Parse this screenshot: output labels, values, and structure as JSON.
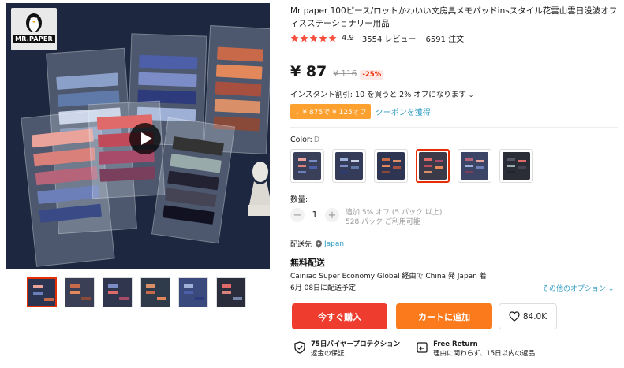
{
  "gallery": {
    "logo_text": "MR.PAPER",
    "thumbnail_count": 6
  },
  "product": {
    "title": "Mr paper 100ピース/ロットかわいい文房具メモパッドinsスタイル花雲山雲日没波オフィスステーショナリー用品",
    "rating": "4.9",
    "reviews": "3554 レビュー",
    "orders": "6591 注文"
  },
  "price": {
    "current": "¥ 87",
    "original": "¥ 116",
    "discount": "-25%"
  },
  "promo": {
    "instant_discount": "インスタント割引: 10 を買うと 2% オフになります",
    "coupon_badge": "¥ 875で ¥ 125オフ",
    "coupon_link": "クーポンを獲得"
  },
  "color": {
    "label": "Color:",
    "selected": "D",
    "options": [
      "A",
      "B",
      "C",
      "D",
      "E",
      "F"
    ]
  },
  "quantity": {
    "label": "数量:",
    "value": "1",
    "minus": "−",
    "plus": "+",
    "bulk_note": "追加 5% オフ (5 パック 以上)",
    "available": "528 パック ご利用可能"
  },
  "shipping": {
    "ship_to_label": "配送先",
    "country": "Japan",
    "free_shipping": "無料配送",
    "detail": "Cainiao Super Economy Global 経由で China 発 Japan 着",
    "date": "6月 08日に配送予定",
    "other_options": "その他のオプション"
  },
  "actions": {
    "buy_now": "今すぐ購入",
    "add_to_cart": "カートに追加",
    "wishlist_count": "84.0K"
  },
  "guarantees": {
    "protection_title": "75日バイヤープロテクション",
    "protection_sub": "返金の保証",
    "return_title": "Free Return",
    "return_sub": "理由に関わらず、15日以内の返品"
  },
  "colors": {
    "accent": "#e62e04",
    "buy_button": "#ee3d2f",
    "cart_button": "#fa7a1c",
    "coupon": "#fca030",
    "link": "#2e9cc3",
    "star": "#f74e3d"
  }
}
